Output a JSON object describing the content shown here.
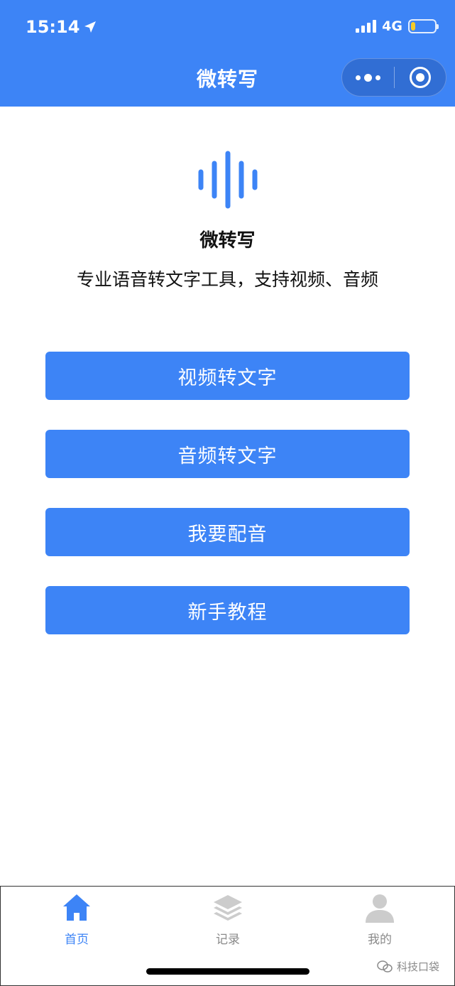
{
  "status_bar": {
    "time": "15:14",
    "network": "4G",
    "battery_level_percent": 20,
    "battery_color": "#f5cc2a"
  },
  "nav": {
    "title": "微转写",
    "more_icon": "more-dots-icon",
    "close_icon": "target-circle-icon"
  },
  "hero": {
    "logo_icon": "sound-wave-icon",
    "app_name": "微转写",
    "tagline": "专业语音转文字工具，支持视频、音频"
  },
  "actions": [
    {
      "label": "视频转文字"
    },
    {
      "label": "音频转文字"
    },
    {
      "label": "我要配音"
    },
    {
      "label": "新手教程"
    }
  ],
  "tabbar": {
    "tabs": [
      {
        "label": "首页",
        "icon": "home-icon",
        "active": true
      },
      {
        "label": "记录",
        "icon": "layers-icon",
        "active": false
      },
      {
        "label": "我的",
        "icon": "user-icon",
        "active": false
      }
    ]
  },
  "watermark": {
    "text": "科技口袋"
  },
  "colors": {
    "brand": "#3d84f6",
    "tab_active": "#3d84f6",
    "tab_inactive": "#8a8a8a",
    "icon_inactive": "#cccccc"
  }
}
